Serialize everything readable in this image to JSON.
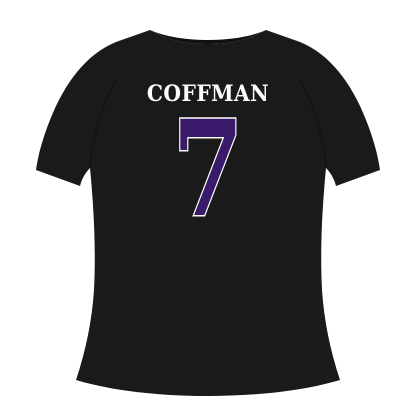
{
  "jersey": {
    "name": "COFFMAN",
    "number": "7"
  },
  "colors": {
    "background": "#ffffff",
    "shirt": "#1b1a1a",
    "shirt_shade": "#121111",
    "name_text": "#ffffff",
    "number_fill": "#3a1b6b",
    "number_outline": "#ffffff"
  }
}
